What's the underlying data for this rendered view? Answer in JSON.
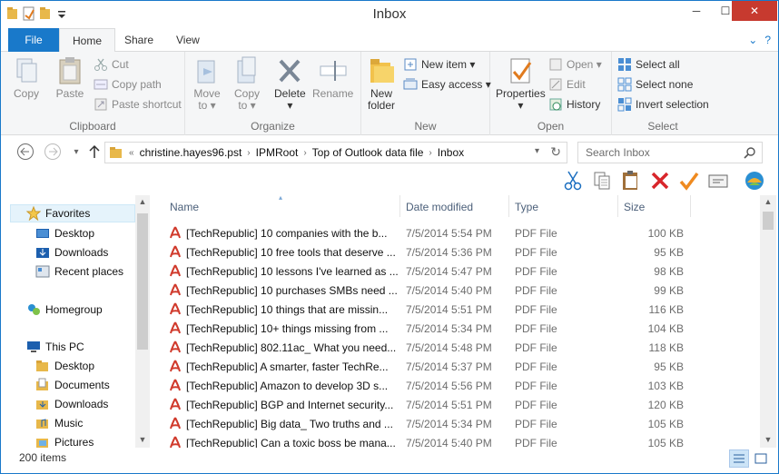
{
  "window": {
    "title": "Inbox",
    "min": "─",
    "max": "☐",
    "close": "✕"
  },
  "tabs": [
    {
      "label": "File"
    },
    {
      "label": "Home"
    },
    {
      "label": "Share"
    },
    {
      "label": "View"
    }
  ],
  "ribbon": {
    "clipboard": {
      "label": "Clipboard",
      "copy": "Copy",
      "paste": "Paste",
      "cut": "Cut",
      "copy_path": "Copy path",
      "paste_shortcut": "Paste shortcut"
    },
    "organize": {
      "label": "Organize",
      "move_to": "Move",
      "move_to2": "to ▾",
      "copy_to": "Copy",
      "copy_to2": "to ▾",
      "delete": "Delete",
      "delete2": "▾",
      "rename": "Rename"
    },
    "new": {
      "label": "New",
      "new_folder": "New",
      "new_folder2": "folder",
      "new_item": "New item ▾",
      "easy_access": "Easy access ▾"
    },
    "open": {
      "label": "Open",
      "properties": "Properties",
      "properties2": "▾",
      "open": "Open ▾",
      "edit": "Edit",
      "history": "History"
    },
    "select": {
      "label": "Select",
      "select_all": "Select all",
      "select_none": "Select none",
      "invert": "Invert selection"
    }
  },
  "address": {
    "chevron": "«",
    "crumbs": [
      "christine.hayes96.pst",
      "IPMRoot",
      "Top of Outlook data file",
      "Inbox"
    ],
    "sep": "›",
    "refresh": "↻",
    "search_placeholder": "Search Inbox"
  },
  "nav": {
    "favorites": "Favorites",
    "desktop": "Desktop",
    "downloads": "Downloads",
    "recent": "Recent places",
    "homegroup": "Homegroup",
    "thispc": "This PC",
    "pc_desktop": "Desktop",
    "documents": "Documents",
    "pc_downloads": "Downloads",
    "music": "Music",
    "pictures": "Pictures"
  },
  "columns": {
    "name": "Name",
    "date": "Date modified",
    "type": "Type",
    "size": "Size"
  },
  "files": [
    {
      "name": "[TechRepublic] 10 companies with the b...",
      "date": "7/5/2014 5:54 PM",
      "type": "PDF File",
      "size": "100 KB"
    },
    {
      "name": "[TechRepublic] 10 free tools that deserve ...",
      "date": "7/5/2014 5:36 PM",
      "type": "PDF File",
      "size": "95 KB"
    },
    {
      "name": "[TechRepublic] 10 lessons I've learned as ...",
      "date": "7/5/2014 5:47 PM",
      "type": "PDF File",
      "size": "98 KB"
    },
    {
      "name": "[TechRepublic] 10 purchases SMBs need ...",
      "date": "7/5/2014 5:40 PM",
      "type": "PDF File",
      "size": "99 KB"
    },
    {
      "name": "[TechRepublic] 10 things that are missin...",
      "date": "7/5/2014 5:51 PM",
      "type": "PDF File",
      "size": "116 KB"
    },
    {
      "name": "[TechRepublic] 10+ things missing from ...",
      "date": "7/5/2014 5:34 PM",
      "type": "PDF File",
      "size": "104 KB"
    },
    {
      "name": "[TechRepublic] 802.11ac_ What you need...",
      "date": "7/5/2014 5:48 PM",
      "type": "PDF File",
      "size": "118 KB"
    },
    {
      "name": "[TechRepublic] A smarter, faster TechRe...",
      "date": "7/5/2014 5:37 PM",
      "type": "PDF File",
      "size": "95 KB"
    },
    {
      "name": "[TechRepublic] Amazon to develop 3D s...",
      "date": "7/5/2014 5:56 PM",
      "type": "PDF File",
      "size": "103 KB"
    },
    {
      "name": "[TechRepublic] BGP and Internet security...",
      "date": "7/5/2014 5:51 PM",
      "type": "PDF File",
      "size": "120 KB"
    },
    {
      "name": "[TechRepublic] Big data_ Two truths and ...",
      "date": "7/5/2014 5:34 PM",
      "type": "PDF File",
      "size": "105 KB"
    },
    {
      "name": "[TechRepublic] Can a toxic boss be mana...",
      "date": "7/5/2014 5:40 PM",
      "type": "PDF File",
      "size": "105 KB"
    }
  ],
  "status": {
    "count": "200 items"
  },
  "colors": {
    "accent": "#1979ca",
    "close": "#c73a2f",
    "pdf": "#d0392b",
    "folder": "#e8b84a"
  }
}
